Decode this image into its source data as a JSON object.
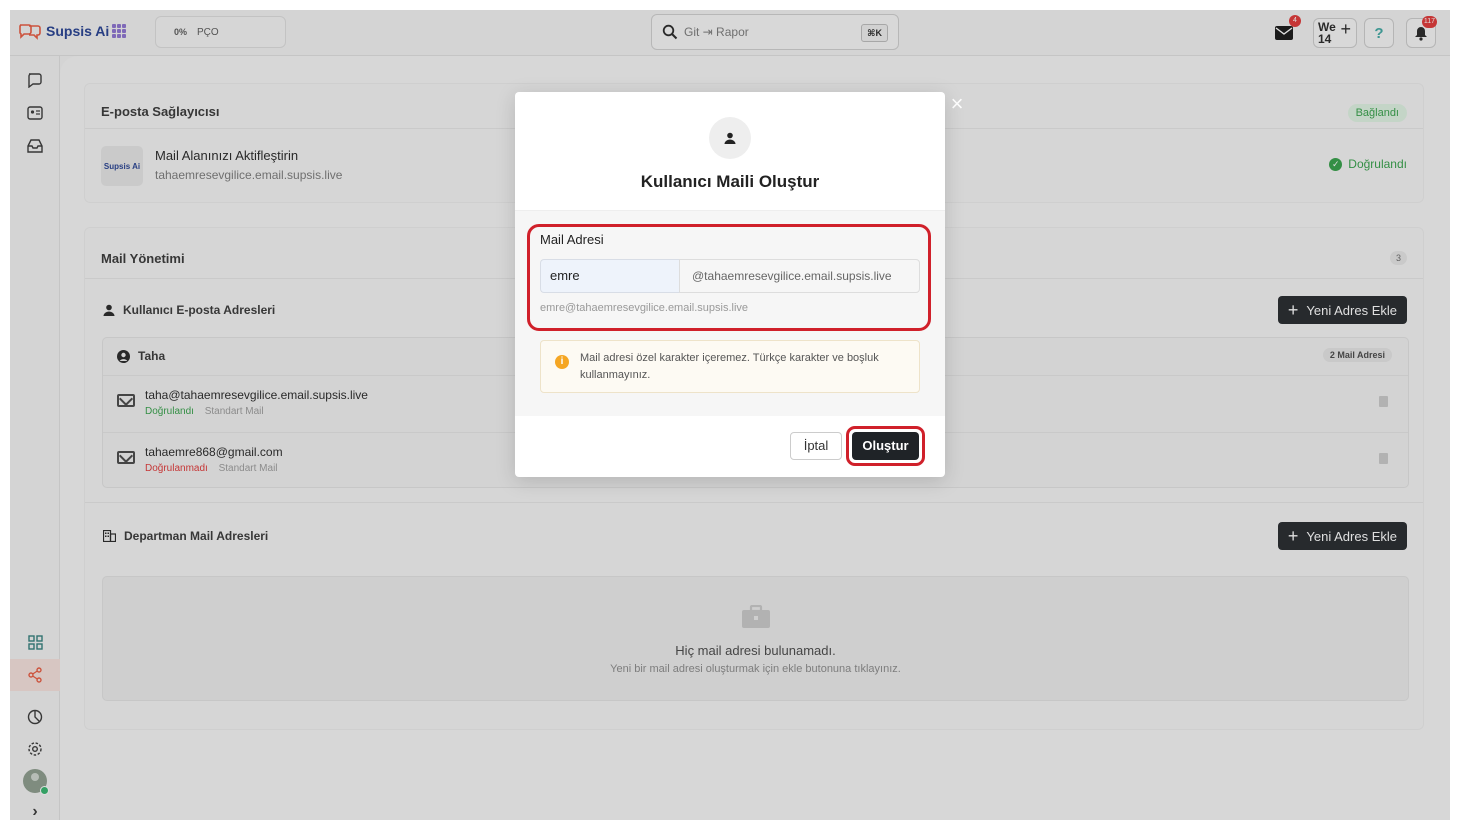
{
  "app": {
    "brand": "Supsis Ai"
  },
  "topbar": {
    "progress_percent": "0%",
    "progress_label": "PÇO",
    "search_placeholder": "Git ⇥ Rapor",
    "search_shortcut": "⌘K",
    "mail_badge": "4",
    "week_label": "We",
    "week_number": "14",
    "notif_badge": "117"
  },
  "email_provider": {
    "title": "E-posta Sağlayıcısı",
    "status": "Bağlandı",
    "domain_title": "Mail Alanınızı Aktifleştirin",
    "domain": "tahaemresevgilice.email.supsis.live",
    "domain_status": "Doğrulandı",
    "logo_text": "Supsis Ai"
  },
  "mail_management": {
    "title": "Mail Yönetimi",
    "count": "3",
    "user_section_title": "Kullanıcı E-posta Adresleri",
    "add_button": "Yeni Adres Ekle",
    "user_group": {
      "name": "Taha",
      "count_label": "2 Mail Adresi",
      "items": [
        {
          "address": "taha@tahaemresevgilice.email.supsis.live",
          "status": "Doğrulandı",
          "type": "Standart Mail"
        },
        {
          "address": "tahaemre868@gmail.com",
          "status": "Doğrulanmadı",
          "type": "Standart Mail"
        }
      ]
    },
    "dept_section_title": "Departman Mail Adresleri",
    "dept_add_button": "Yeni Adres Ekle",
    "empty_title": "Hiç mail adresi bulunamadı.",
    "empty_subtitle": "Yeni bir mail adresi oluşturmak için ekle butonuna tıklayınız."
  },
  "modal": {
    "title": "Kullanıcı Maili Oluştur",
    "field_label": "Mail Adresi",
    "input_value": "emre",
    "domain_suffix": "@tahaemresevgilice.email.supsis.live",
    "preview": "emre@tahaemresevgilice.email.supsis.live",
    "warning": "Mail adresi özel karakter içeremez. Türkçe karakter ve boşluk kullanmayınız.",
    "cancel_label": "İptal",
    "create_label": "Oluştur",
    "close_label": "×"
  },
  "colors": {
    "accent": "#1f2327",
    "success": "#2f9e44",
    "danger": "#e03131",
    "highlight": "#d0202a",
    "warning": "#f5a623"
  }
}
